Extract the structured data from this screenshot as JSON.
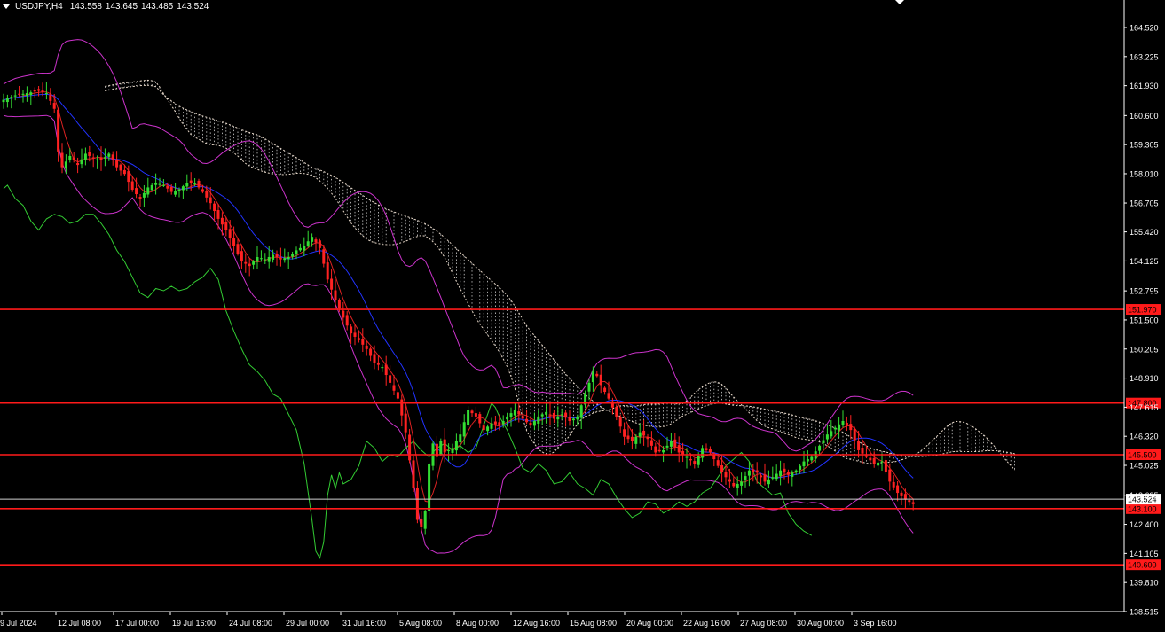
{
  "header": {
    "symbol": "USDJPY,H4",
    "open": "143.558",
    "high": "143.645",
    "low": "143.485",
    "close": "143.524"
  },
  "chart_data": {
    "type": "candlestick",
    "symbol": "USDJPY",
    "timeframe": "H4",
    "ylim": [
      138.0,
      165.6
    ],
    "y_ticks": [
      "164.520",
      "163.225",
      "161.930",
      "160.600",
      "159.305",
      "158.010",
      "156.705",
      "155.420",
      "154.125",
      "152.795",
      "151.500",
      "150.205",
      "148.910",
      "147.615",
      "146.320",
      "145.025",
      "143.695",
      "142.400",
      "141.105",
      "139.810",
      "138.515"
    ],
    "x_ticks": [
      "9 Jul 2024",
      "12 Jul 08:00",
      "17 Jul 00:00",
      "19 Jul 16:00",
      "24 Jul 08:00",
      "29 Jul 00:00",
      "31 Jul 16:00",
      "5 Aug 08:00",
      "8 Aug 00:00",
      "12 Aug 16:00",
      "15 Aug 08:00",
      "20 Aug 00:00",
      "22 Aug 16:00",
      "27 Aug 08:00",
      "30 Aug 00:00",
      "3 Sep 16:00"
    ],
    "current_price": "143.524",
    "horizontal_levels": [
      {
        "label": "151.970",
        "value": 151.97
      },
      {
        "label": "147.800",
        "value": 147.8
      },
      {
        "label": "145.500",
        "value": 145.5
      },
      {
        "label": "143.100",
        "value": 143.1
      },
      {
        "label": "140.600",
        "value": 140.6
      }
    ],
    "close_path": [
      [
        0,
        161.3
      ],
      [
        3,
        161.5
      ],
      [
        6,
        161.6
      ],
      [
        9,
        161.7
      ],
      [
        11,
        161.6
      ],
      [
        13,
        160.9
      ],
      [
        14,
        159.0
      ],
      [
        15,
        158.3
      ],
      [
        17,
        158.8
      ],
      [
        19,
        158.4
      ],
      [
        21,
        158.9
      ],
      [
        23,
        158.7
      ],
      [
        25,
        158.6
      ],
      [
        27,
        158.9
      ],
      [
        29,
        158.3
      ],
      [
        31,
        158.0
      ],
      [
        33,
        157.3
      ],
      [
        35,
        156.9
      ],
      [
        37,
        157.4
      ],
      [
        39,
        157.6
      ],
      [
        41,
        157.5
      ],
      [
        43,
        157.2
      ],
      [
        45,
        157.3
      ],
      [
        47,
        157.6
      ],
      [
        49,
        157.6
      ],
      [
        51,
        157.2
      ],
      [
        53,
        156.7
      ],
      [
        55,
        156.0
      ],
      [
        57,
        155.5
      ],
      [
        59,
        154.8
      ],
      [
        61,
        154.1
      ],
      [
        63,
        153.9
      ],
      [
        65,
        154.3
      ],
      [
        67,
        154.2
      ],
      [
        69,
        154.4
      ],
      [
        71,
        154.2
      ],
      [
        73,
        154.3
      ],
      [
        75,
        154.6
      ],
      [
        77,
        154.8
      ],
      [
        79,
        155.2
      ],
      [
        81,
        154.7
      ],
      [
        83,
        153.3
      ],
      [
        85,
        152.4
      ],
      [
        87,
        151.6
      ],
      [
        89,
        150.9
      ],
      [
        91,
        150.6
      ],
      [
        93,
        150.2
      ],
      [
        95,
        149.6
      ],
      [
        97,
        149.4
      ],
      [
        99,
        148.7
      ],
      [
        101,
        148.0
      ],
      [
        103,
        146.5
      ],
      [
        105,
        144.0
      ],
      [
        106,
        142.6
      ],
      [
        107,
        142.3
      ],
      [
        108,
        143.0
      ],
      [
        109,
        145.1
      ],
      [
        110,
        146.0
      ],
      [
        111,
        145.4
      ],
      [
        112,
        146.1
      ],
      [
        113,
        145.6
      ],
      [
        115,
        145.8
      ],
      [
        117,
        146.4
      ],
      [
        119,
        147.5
      ],
      [
        121,
        147.2
      ],
      [
        123,
        146.6
      ],
      [
        125,
        146.9
      ],
      [
        127,
        146.8
      ],
      [
        129,
        147.2
      ],
      [
        131,
        147.5
      ],
      [
        133,
        147.1
      ],
      [
        135,
        146.8
      ],
      [
        137,
        147.2
      ],
      [
        139,
        147.4
      ],
      [
        141,
        147.1
      ],
      [
        143,
        147.3
      ],
      [
        145,
        147.0
      ],
      [
        147,
        147.2
      ],
      [
        149,
        148.2
      ],
      [
        151,
        149.2
      ],
      [
        152,
        149.0
      ],
      [
        153,
        148.6
      ],
      [
        155,
        148.0
      ],
      [
        157,
        147.2
      ],
      [
        159,
        146.3
      ],
      [
        161,
        146.1
      ],
      [
        163,
        146.5
      ],
      [
        165,
        146.2
      ],
      [
        167,
        145.6
      ],
      [
        169,
        145.7
      ],
      [
        171,
        146.1
      ],
      [
        173,
        145.6
      ],
      [
        175,
        145.4
      ],
      [
        177,
        145.1
      ],
      [
        179,
        145.8
      ],
      [
        181,
        145.6
      ],
      [
        183,
        145.0
      ],
      [
        185,
        144.5
      ],
      [
        187,
        144.1
      ],
      [
        189,
        144.3
      ],
      [
        191,
        144.8
      ],
      [
        193,
        144.7
      ],
      [
        195,
        144.3
      ],
      [
        197,
        144.5
      ],
      [
        199,
        144.8
      ],
      [
        201,
        144.6
      ],
      [
        203,
        144.8
      ],
      [
        205,
        145.2
      ],
      [
        207,
        145.4
      ],
      [
        209,
        145.9
      ],
      [
        211,
        146.4
      ],
      [
        213,
        146.7
      ],
      [
        215,
        147.0
      ],
      [
        217,
        146.6
      ],
      [
        219,
        145.7
      ],
      [
        221,
        145.4
      ],
      [
        223,
        145.1
      ],
      [
        225,
        145.2
      ],
      [
        227,
        144.3
      ],
      [
        229,
        143.8
      ],
      [
        231,
        143.5
      ],
      [
        233,
        143.3
      ]
    ],
    "overlay_series": [
      "Bollinger Bands (upper / lower)",
      "Moving averages (blue, red)",
      "Chikou span (green)",
      "Ichimoku cloud (dotted)"
    ]
  }
}
